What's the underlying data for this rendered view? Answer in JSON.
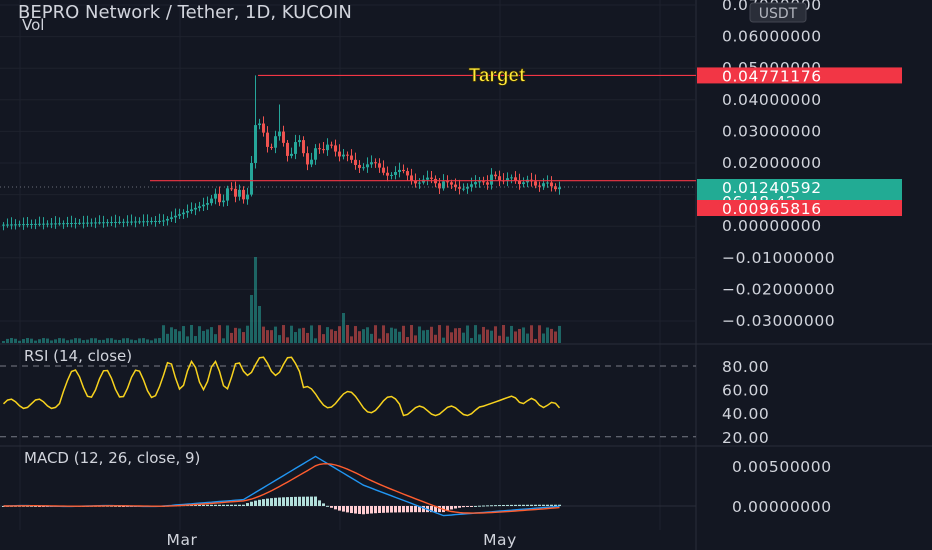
{
  "header": {
    "title": "BEPRO Network / Tether, 1D, KUCOIN",
    "volume_label": "Vol",
    "currency_badge": "USDT"
  },
  "annotations": {
    "target_label": "Target"
  },
  "price_axis": {
    "tick_labels": [
      "0.07000000",
      "0.06000000",
      "0.05000000",
      "0.04000000",
      "0.03000000",
      "0.02000000",
      "0.01000000",
      "0.00000000",
      "−0.01000000",
      "−0.02000000",
      "−0.03000000"
    ],
    "target_tag": "0.04771176",
    "last_price_tag": "0.01240592",
    "countdown_tag": "06:48:42",
    "support_tag": "0.00965816"
  },
  "rsi_pane": {
    "title": "RSI (14, close)",
    "tick_labels": [
      "80.00",
      "60.00",
      "40.00",
      "20.00"
    ]
  },
  "macd_pane": {
    "title": "MACD (12, 26, close, 9)",
    "tick_labels": [
      "0.00500000",
      "0.00000000"
    ]
  },
  "time_axis": {
    "labels": [
      "Mar",
      "May"
    ]
  },
  "colors": {
    "background": "#131722",
    "up": "#26a69a",
    "down": "#ef5350",
    "rsi_line": "#f7d21e",
    "macd_line": "#2196f3",
    "signal_line": "#ff5d2e",
    "target_text": "#ffeb3b",
    "level_line": "#f23645"
  },
  "chart_data": [
    {
      "type": "candlestick",
      "title": "BEPRO Network / Tether, 1D, KUCOIN",
      "y_range": [
        -0.035,
        0.07
      ],
      "x_labels": [
        "Mar",
        "May"
      ],
      "levels": [
        {
          "name": "Target",
          "value": 0.04771176
        },
        {
          "value": 0.00965816
        }
      ],
      "last_price": 0.01240592,
      "series_description": "daily OHLC; low ~0.002 in early period, spike to ~0.0477, later ranging 0.0100-0.0210",
      "candle_count": 140,
      "volume": "histogram under candles, largest bars near spike"
    },
    {
      "type": "line",
      "title": "RSI (14, close)",
      "ylim": [
        20,
        90
      ],
      "guides": [
        80,
        20
      ],
      "approx_range": [
        34,
        90
      ]
    },
    {
      "type": "line",
      "title": "MACD (12, 26, close, 9)",
      "series_lines": [
        "MACD",
        "Signal"
      ],
      "histogram": true,
      "approx_macd_range": [
        -0.0012,
        0.0062
      ]
    }
  ]
}
